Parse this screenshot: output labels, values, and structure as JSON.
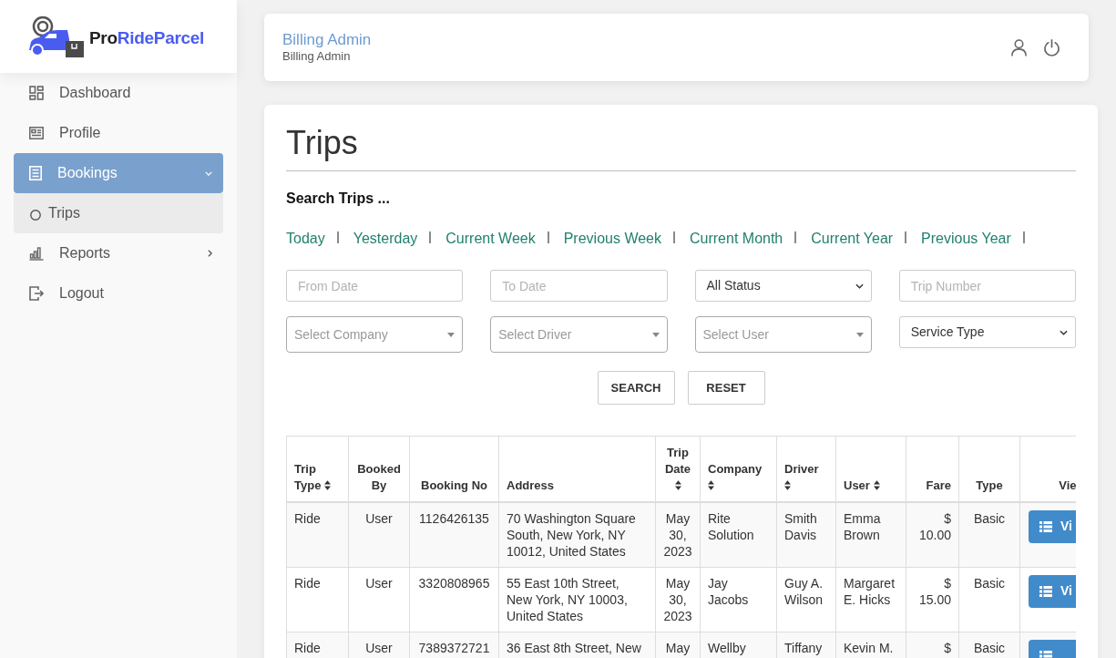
{
  "logo": {
    "parts": [
      "Pro",
      "RideParcel"
    ]
  },
  "sidebar": {
    "items": [
      {
        "label": "Dashboard",
        "kind": "link",
        "selected": false
      },
      {
        "label": "Profile",
        "kind": "link",
        "selected": false
      },
      {
        "label": "Bookings",
        "kind": "menu",
        "selected": true,
        "expanded": true,
        "children": [
          {
            "label": "Trips",
            "selected": true
          }
        ]
      },
      {
        "label": "Reports",
        "kind": "menu",
        "selected": false,
        "expanded": false
      },
      {
        "label": "Logout",
        "kind": "link",
        "selected": false
      }
    ]
  },
  "header": {
    "title": "Billing Admin",
    "subtitle": "Billing Admin"
  },
  "page": {
    "title": "Trips",
    "search_heading": "Search Trips ...",
    "quick_ranges": [
      "Today",
      "Yesterday",
      "Current Week",
      "Previous Week",
      "Current Month",
      "Current Year",
      "Previous Year"
    ],
    "filters": [
      {
        "kind": "input",
        "placeholder": "From Date"
      },
      {
        "kind": "input",
        "placeholder": "To Date"
      },
      {
        "kind": "select",
        "value": "All Status"
      },
      {
        "kind": "input",
        "placeholder": "Trip Number"
      },
      {
        "kind": "combo",
        "placeholder": "Select Company"
      },
      {
        "kind": "combo",
        "placeholder": "Select Driver"
      },
      {
        "kind": "combo",
        "placeholder": "Select User"
      },
      {
        "kind": "select",
        "value": "Service Type"
      }
    ],
    "buttons": [
      "SEARCH",
      "RESET"
    ]
  },
  "table": {
    "columns": [
      {
        "label": "Trip Type",
        "sortable": true
      },
      {
        "label": "Booked By",
        "sortable": false
      },
      {
        "label": "Booking No",
        "sortable": false
      },
      {
        "label": "Address",
        "sortable": false
      },
      {
        "label": "Trip Date",
        "sortable": true
      },
      {
        "label": "Company",
        "sortable": true
      },
      {
        "label": "Driver",
        "sortable": true
      },
      {
        "label": "User",
        "sortable": true
      },
      {
        "label": "Fare",
        "sortable": false
      },
      {
        "label": "Type",
        "sortable": false
      },
      {
        "label": "Vie",
        "sortable": false
      }
    ],
    "rows": [
      {
        "cells": [
          "Ride",
          "User",
          "1126426135",
          "70 Washington Square South, New York, NY 10012, United States",
          "May 30, 2023",
          "Rite Solution",
          "Smith Davis",
          "Emma Brown",
          "$ 10.00",
          "Basic"
        ],
        "view": "Vi"
      },
      {
        "cells": [
          "Ride",
          "User",
          "3320808965",
          "55 East 10th Street, New York, NY 10003, United States",
          "May 30, 2023",
          "Jay Jacobs",
          "Guy A. Wilson",
          "Margaret E. Hicks",
          "$ 15.00",
          "Basic"
        ],
        "view": "Vi"
      },
      {
        "cells": [
          "Ride",
          "User",
          "7389372721",
          "36 East 8th Street, New",
          "May",
          "Wellby",
          "Tiffany",
          "Kevin M.",
          "$",
          "Basic"
        ]
      }
    ]
  }
}
